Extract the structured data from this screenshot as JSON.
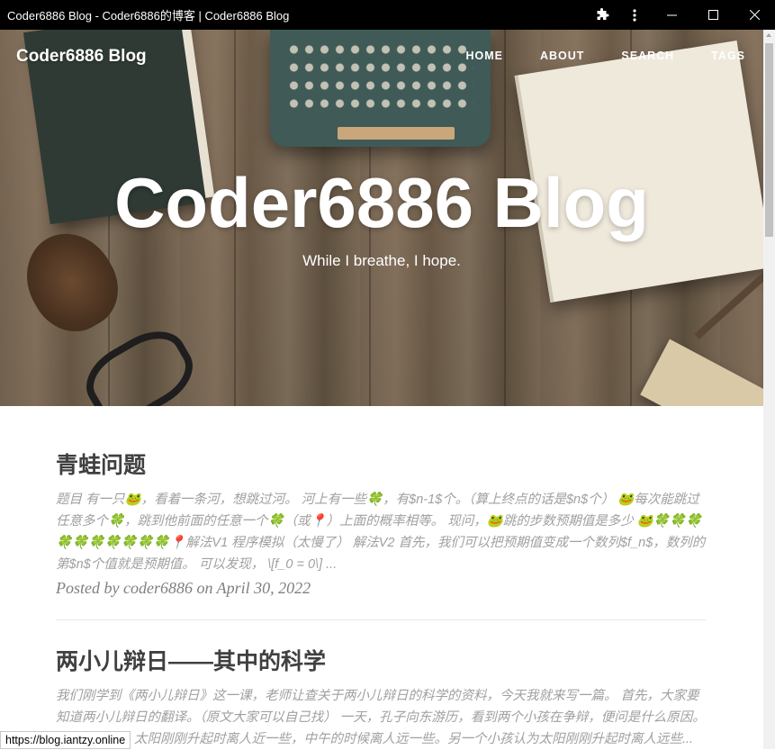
{
  "window": {
    "title": "Coder6886 Blog - Coder6886的博客 | Coder6886 Blog",
    "icons": [
      "extensions-icon",
      "more-vert-icon",
      "minimize-icon",
      "maximize-icon",
      "close-icon"
    ]
  },
  "nav": {
    "brand": "Coder6886 Blog",
    "links": [
      "HOME",
      "ABOUT",
      "SEARCH",
      "TAGS"
    ]
  },
  "hero": {
    "title": "Coder6886 Blog",
    "subtitle": "While I breathe, I hope."
  },
  "posts": [
    {
      "title": "青蛙问题",
      "excerpt": "题目 有一只🐸，看着一条河，想跳过河。 河上有一些🍀，有$n-1$个。（算上终点的话是$n$个） 🐸每次能跳过任意多个🍀，跳到他前面的任意一个🍀（或📍）上面的概率相等。 现问，🐸跳的步数预期值是多少 🐸🍀🍀🍀🍀🍀🍀🍀🍀🍀🍀📍解法V1 程序模拟（太慢了） 解法V2 首先，我们可以把预期值变成一个数列$f_n$，数列的第$n$个值就是预期值。 可以发现， \\[f_0 = 0\\] ...",
      "meta": "Posted by coder6886 on April 30, 2022"
    },
    {
      "title": "两小儿辩日——其中的科学",
      "excerpt": "我们刚学到《两小儿辩日》这一课，老师让查关于两小儿辩日的科学的资料，今天我就来写一篇。 首先，大家要知道两小儿辩日的翻译。（原文大家可以自己找） 一天，孔子向东游历，看到两个小孩在争辩，便问是什么原因。 一个小孩说：太阳刚刚升起时离人近一些，中午的时候离人远一些。另一个小孩认为太阳刚刚升起时离人远些..."
    }
  ],
  "status": {
    "url": "https://blog.iantzy.online"
  }
}
